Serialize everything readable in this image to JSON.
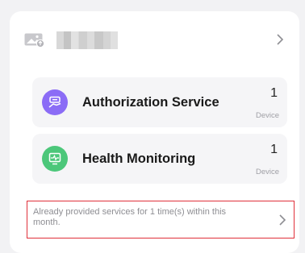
{
  "device": {
    "icon": "image-icon",
    "name_redacted": true
  },
  "services": [
    {
      "name": "Authorization Service",
      "count": "1",
      "unit": "Device",
      "icon": "authorization-icon",
      "color": "#8b6cf6"
    },
    {
      "name": "Health Monitoring",
      "count": "1",
      "unit": "Device",
      "icon": "heart-monitor-icon",
      "color": "#4cc77a"
    }
  ],
  "notice": {
    "text": "Already provided services for 1 time(s) within this month."
  }
}
